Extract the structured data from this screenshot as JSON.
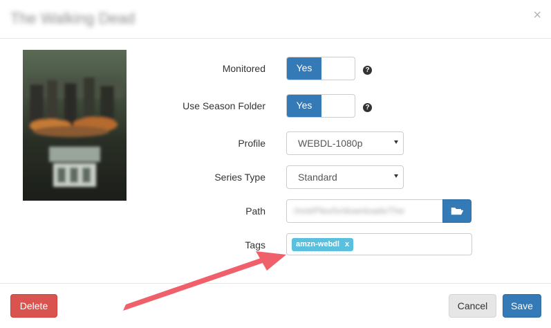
{
  "header": {
    "title": "The Walking Dead",
    "close_glyph": "×"
  },
  "poster": {
    "alt": "The Walking Dead"
  },
  "form": {
    "monitored": {
      "label": "Monitored",
      "value": "Yes"
    },
    "season_folder": {
      "label": "Use Season Folder",
      "value": "Yes"
    },
    "profile": {
      "label": "Profile",
      "selected": "WEBDL-1080p"
    },
    "series_type": {
      "label": "Series Type",
      "selected": "Standard"
    },
    "path": {
      "label": "Path",
      "value": "/mnt/Plex/tv/downloads/The"
    },
    "tags": {
      "label": "Tags",
      "items": [
        {
          "label": "amzn-webdl",
          "remove_glyph": "x"
        }
      ]
    }
  },
  "footer": {
    "delete_label": "Delete",
    "cancel_label": "Cancel",
    "save_label": "Save"
  },
  "colors": {
    "primary": "#337ab7",
    "danger": "#d9534f",
    "info": "#5bc0de",
    "annotation_arrow": "#f0606a"
  },
  "icons": {
    "help": "question-circle-icon",
    "folder": "folder-open-icon",
    "close": "close-icon",
    "caret": "caret-down-icon"
  }
}
